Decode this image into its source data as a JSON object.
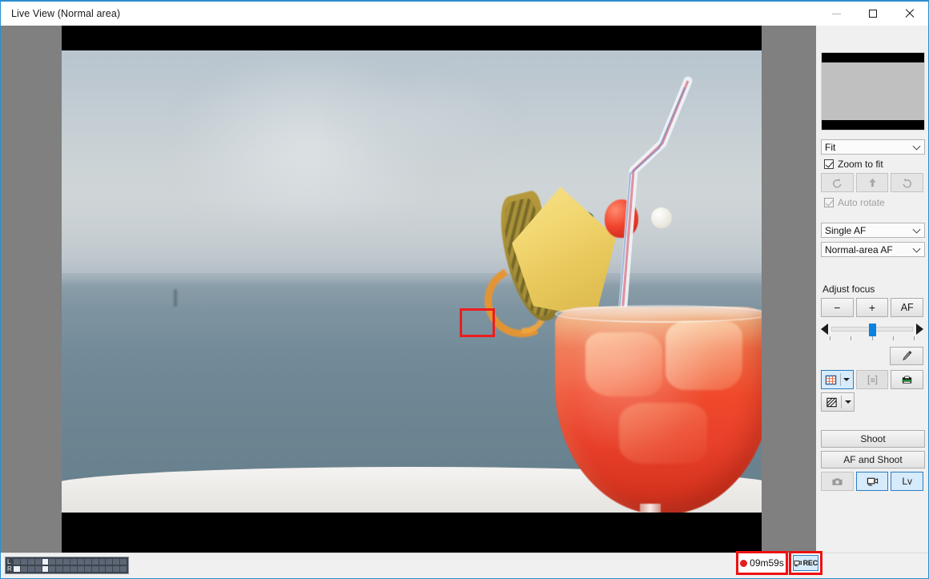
{
  "window": {
    "title": "Live View (Normal area)",
    "controls": {
      "minimize": "minimize-button",
      "maximize": "maximize-button",
      "close": "close-button"
    }
  },
  "liveview": {
    "af_point": {
      "label": "af-area-rectangle",
      "color": "#ee1c1c"
    },
    "scene": "tropical cocktail on white table with sea horizon"
  },
  "panel": {
    "navigator": {
      "label": "navigator-thumbnail"
    },
    "zoom_select": {
      "value": "Fit"
    },
    "zoom_to_fit": {
      "label": "Zoom to fit",
      "checked": true
    },
    "rotate": {
      "rotate_left": "Rotate left",
      "flip": "Flip",
      "rotate_right": "Rotate right",
      "enabled": false
    },
    "auto_rotate": {
      "label": "Auto rotate",
      "checked": true,
      "enabled": false
    },
    "af_mode_select": {
      "value": "Single AF"
    },
    "af_area_select": {
      "value": "Normal-area AF"
    },
    "focus": {
      "label": "Adjust focus",
      "minus": "−",
      "plus": "+",
      "af": "AF",
      "slider_value": 50,
      "slider_min": 0,
      "slider_max": 100,
      "tick_count": 5
    },
    "tools": {
      "eyedropper": "white-balance-eyedropper",
      "grid": "grid-overlay",
      "grid_active": true,
      "focus_area": "focus-area-display",
      "focus_area_enabled": false,
      "level": "virtual-horizon",
      "shading": "shading-overlay"
    },
    "shoot": {
      "label": "Shoot"
    },
    "af_and_shoot": {
      "label": "AF and Shoot"
    },
    "modes": {
      "photo": {
        "label": "photo-mode",
        "active": false,
        "enabled": false
      },
      "movie": {
        "label": "movie-mode",
        "active": true
      },
      "lv": {
        "label": "Lv",
        "active": true
      }
    }
  },
  "statusbar": {
    "audio_meter": {
      "left_label": "L",
      "right_label": "R",
      "segments": 16,
      "left_on": [
        4
      ],
      "right_on": [
        0,
        4
      ]
    }
  },
  "annotations": {
    "rec_time": "09m59s",
    "rec_button_label": "REC",
    "highlight_color": "#ee1111"
  }
}
